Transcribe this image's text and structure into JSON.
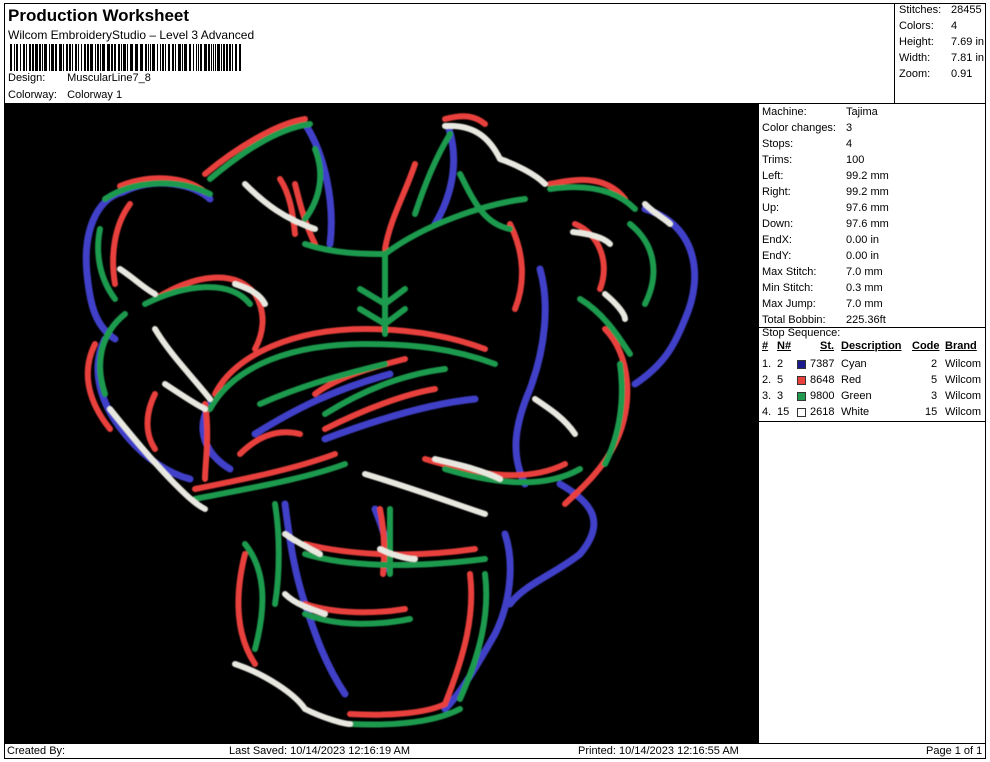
{
  "header": {
    "title": "Production Worksheet",
    "subtitle": "Wilcom EmbroideryStudio – Level 3 Advanced",
    "design_label": "Design:",
    "design_value": "MuscularLine7_8",
    "colorway_label": "Colorway:",
    "colorway_value": "Colorway 1"
  },
  "stats": [
    {
      "label": "Stitches:",
      "value": "28455"
    },
    {
      "label": "Colors:",
      "value": "4"
    },
    {
      "label": "Height:",
      "value": "7.69 in"
    },
    {
      "label": "Width:",
      "value": "7.81 in"
    },
    {
      "label": "Zoom:",
      "value": "0.91"
    }
  ],
  "machine_info": [
    {
      "label": "Machine:",
      "value": "Tajima"
    },
    {
      "label": "Color changes:",
      "value": "3"
    },
    {
      "label": "Stops:",
      "value": "4"
    },
    {
      "label": "Trims:",
      "value": "100"
    },
    {
      "label": "Left:",
      "value": "99.2 mm"
    },
    {
      "label": "Right:",
      "value": "99.2 mm"
    },
    {
      "label": "Up:",
      "value": "97.6 mm"
    },
    {
      "label": "Down:",
      "value": "97.6 mm"
    },
    {
      "label": "EndX:",
      "value": "0.00 in"
    },
    {
      "label": "EndY:",
      "value": "0.00 in"
    },
    {
      "label": "Max Stitch:",
      "value": "7.0 mm"
    },
    {
      "label": "Min Stitch:",
      "value": "0.3 mm"
    },
    {
      "label": "Max Jump:",
      "value": "7.0 mm"
    },
    {
      "label": "Total Bobbin:",
      "value": "225.36ft"
    }
  ],
  "stop_sequence": {
    "title": "Stop Sequence:",
    "headers": {
      "num": "#",
      "n": "N#",
      "st": "St.",
      "desc": "Description",
      "code": "Code",
      "brand": "Brand"
    },
    "rows": [
      {
        "num": "1.",
        "n": "2",
        "color": "#1a1a8c",
        "st": "7387",
        "desc": "Cyan",
        "code": "2",
        "brand": "Wilcom"
      },
      {
        "num": "2.",
        "n": "5",
        "color": "#e8413c",
        "st": "8648",
        "desc": "Red",
        "code": "5",
        "brand": "Wilcom"
      },
      {
        "num": "3.",
        "n": "3",
        "color": "#1f9a4e",
        "st": "9800",
        "desc": "Green",
        "code": "3",
        "brand": "Wilcom"
      },
      {
        "num": "4.",
        "n": "15",
        "color": "#ffffff",
        "st": "2618",
        "desc": "White",
        "code": "15",
        "brand": "Wilcom"
      }
    ]
  },
  "footer": {
    "created_by": "Created By:",
    "last_saved": "Last Saved: 10/14/2023 12:16:19 AM",
    "printed": "Printed: 10/14/2023 12:16:55 AM",
    "page": "Page 1 of 1"
  },
  "thread_colors": {
    "blue": "#4040c8",
    "red": "#e8413c",
    "green": "#1f9a4e",
    "white": "#e8e8e0"
  }
}
